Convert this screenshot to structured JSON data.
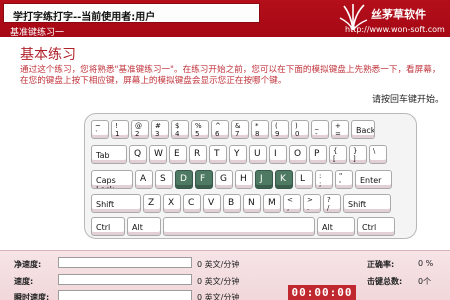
{
  "header": {
    "title": "学打字练打字--当前使用者:用户",
    "subtitle": "基准键练习一",
    "brand": {
      "name": "丝茅草软件",
      "url": "http://www.won-soft.com"
    }
  },
  "content": {
    "section_title": "基本练习",
    "intro": "通过这个练习，您将熟悉\"基准键练习一\"。在练习开始之前，您可以在下面的模拟键盘上先熟悉一下，看屏幕，在您的键盘上按下相应键，屏幕上的模拟键盘会显示您正在按哪个键。",
    "prompt": "请按回车键开始。"
  },
  "keyboard": {
    "row_number": [
      "~|`",
      "!|1",
      "@|2",
      "#|3",
      "$|4",
      "%|5",
      "^|6",
      "&|7",
      "*|8",
      "(|9",
      ")|0",
      "_|-",
      "+|="
    ],
    "backspace": "Back",
    "tab": "Tab",
    "row_qwerty": [
      "Q",
      "W",
      "E",
      "R",
      "T",
      "Y",
      "U",
      "I",
      "O",
      "P"
    ],
    "row_qwerty_symbols": [
      "{|[",
      "}|]",
      "\\||\\\\"
    ],
    "capslock": "Caps Lock",
    "row_home": [
      "A",
      "S",
      "D",
      "F",
      "G",
      "H",
      "J",
      "K",
      "L"
    ],
    "row_home_symbols": [
      ":|;",
      "\"|'"
    ],
    "highlighted_keys": [
      "D",
      "F",
      "J",
      "K"
    ],
    "enter": "Enter",
    "shift_left": "Shift",
    "row_bottom": [
      "Z",
      "X",
      "C",
      "V",
      "B",
      "N",
      "M"
    ],
    "row_bottom_symbols": [
      "<|,",
      ">|.",
      "?|/"
    ],
    "shift_right": "Shift",
    "ctrl_left": "Ctrl",
    "alt_left": "Alt",
    "alt_right": "Alt",
    "ctrl_right": "Ctrl"
  },
  "stats": {
    "net_speed_label": "净速度:",
    "speed_label": "速度:",
    "instant_speed_label": "瞬时速度:",
    "speed_unit": "0 英文/分钟",
    "accuracy_label": "正确率:",
    "accuracy_value": "0 %",
    "keystrokes_label": "击键总数:",
    "keystrokes_value": "0个",
    "timer": "00:00:00"
  },
  "colors": {
    "brand_red": "#b40f1b",
    "highlight_key": "#4e7a63",
    "accent_text": "#c0343c"
  }
}
